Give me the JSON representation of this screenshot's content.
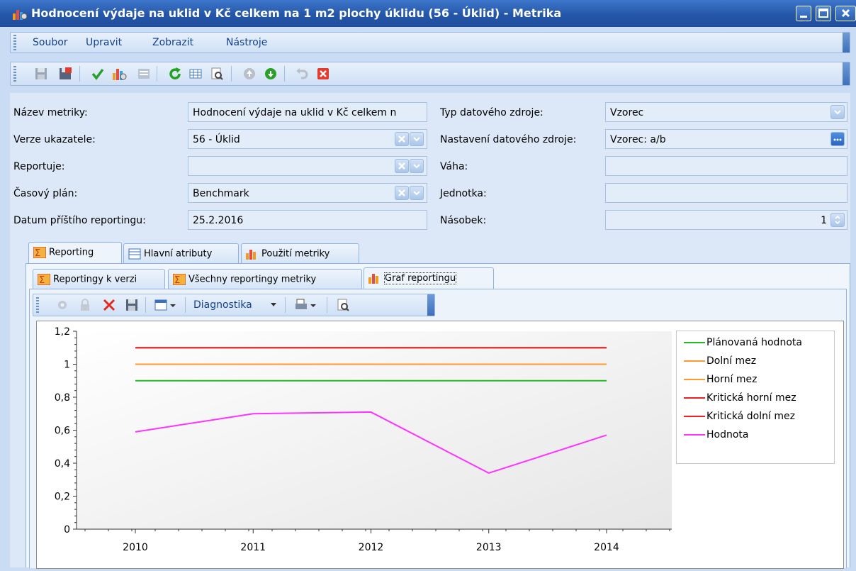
{
  "window": {
    "title": "Hodnocení výdaje na uklid v Kč celkem na 1 m2 plochy úklidu (56 - Úklid) - Metrika"
  },
  "menu": [
    "Soubor",
    "Upravit",
    "Zobrazit",
    "Nástroje"
  ],
  "form": {
    "nazev_label": "Název metriky:",
    "nazev_value": "Hodnocení  výdaje na uklid v Kč celkem n",
    "verze_label": "Verze ukazatele:",
    "verze_value": "56 - Úklid",
    "reportuje_label": "Reportuje:",
    "reportuje_value": "",
    "plan_label": "Časový plán:",
    "plan_value": "Benchmark",
    "datum_label": "Datum příštího reportingu:",
    "datum_value": "25.2.2016",
    "typ_label": "Typ datového zdroje:",
    "typ_value": "Vzorec",
    "nastaveni_label": "Nastavení datového zdroje:",
    "nastaveni_value": "Vzorec: a/b",
    "vaha_label": "Váha:",
    "vaha_value": "",
    "jednotka_label": "Jednotka:",
    "jednotka_value": "",
    "nasobek_label": "Násobek:",
    "nasobek_value": "1"
  },
  "tabs": {
    "main": [
      "Reporting",
      "Hlavní atributy",
      "Použití metriky"
    ],
    "sub": [
      "Reportingy k verzi",
      "Všechny reportingy metriky",
      "Graf reportingu"
    ]
  },
  "chart_toolbar": {
    "diagnostika": "Diagnostika"
  },
  "chart_data": {
    "type": "line",
    "x": [
      "2010",
      "2011",
      "2012",
      "2013",
      "2014"
    ],
    "ylim": [
      0,
      1.2
    ],
    "yticks": [
      "0",
      "0,2",
      "0,4",
      "0,6",
      "0,8",
      "1",
      "1,2"
    ],
    "series": [
      {
        "name": "Plánovaná hodnota",
        "color": "#22bb22",
        "values": [
          0.9,
          0.9,
          0.9,
          0.9,
          0.9
        ]
      },
      {
        "name": "Dolní mez",
        "color": "#ff9933",
        "values": [
          1.0,
          1.0,
          1.0,
          1.0,
          1.0
        ]
      },
      {
        "name": "Horní mez",
        "color": "#ff9933",
        "values": [
          1.0,
          1.0,
          1.0,
          1.0,
          1.0
        ]
      },
      {
        "name": "Kritická horní mez",
        "color": "#ee2222",
        "values": [
          1.1,
          1.1,
          1.1,
          1.1,
          1.1
        ]
      },
      {
        "name": "Kritická dolní mez",
        "color": "#ee2222",
        "values": [
          1.1,
          1.1,
          1.1,
          1.1,
          1.1
        ]
      },
      {
        "name": "Hodnota",
        "color": "#ff33ff",
        "values": [
          0.59,
          0.7,
          0.71,
          0.34,
          0.57
        ]
      }
    ],
    "legend_position": "right"
  }
}
